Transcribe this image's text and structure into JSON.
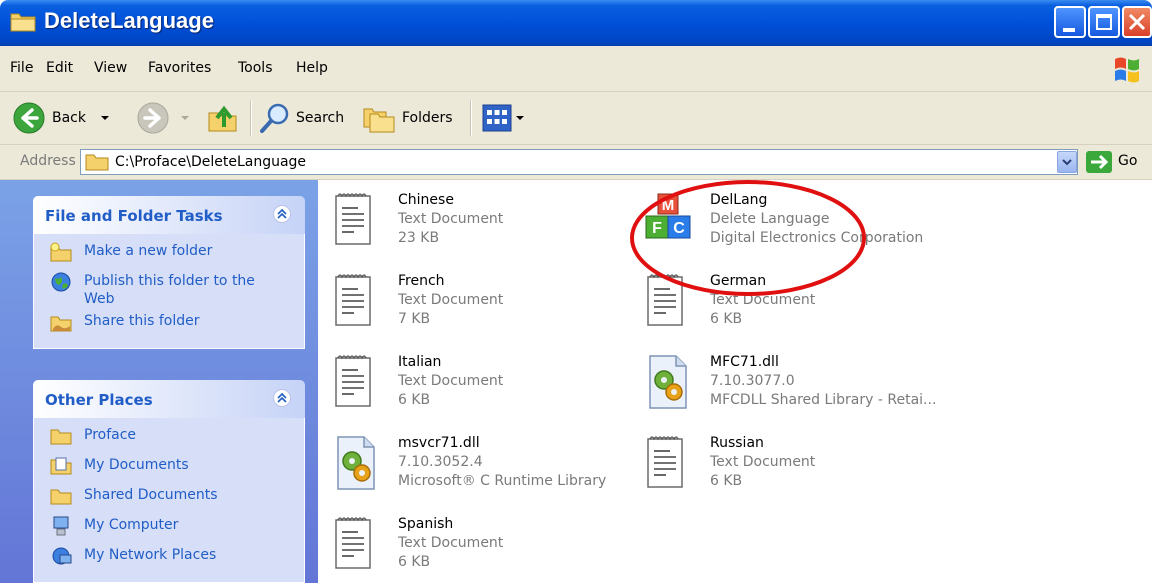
{
  "window": {
    "title": "DeleteLanguage",
    "title_icon": "folder-icon"
  },
  "menu": {
    "items": [
      "File",
      "Edit",
      "View",
      "Favorites",
      "Tools",
      "Help"
    ]
  },
  "toolbar": {
    "back_label": "Back",
    "search_label": "Search",
    "folders_label": "Folders"
  },
  "address": {
    "label": "Address",
    "path": "C:\\Proface\\DeleteLanguage",
    "go_label": "Go"
  },
  "left_pane": {
    "file_tasks": {
      "title": "File and Folder Tasks",
      "items": [
        {
          "label": "Make a new folder",
          "icon": "new-folder-icon"
        },
        {
          "label": "Publish this folder to the Web",
          "icon": "globe-icon"
        },
        {
          "label": "Share this folder",
          "icon": "share-folder-icon"
        }
      ]
    },
    "other_places": {
      "title": "Other Places",
      "items": [
        {
          "label": "Proface",
          "icon": "folder-icon"
        },
        {
          "label": "My Documents",
          "icon": "my-documents-icon"
        },
        {
          "label": "Shared Documents",
          "icon": "folder-icon"
        },
        {
          "label": "My Computer",
          "icon": "computer-icon"
        },
        {
          "label": "My Network Places",
          "icon": "network-icon"
        }
      ]
    }
  },
  "files": [
    {
      "name": "Chinese",
      "type": "Text Document",
      "size": "23 KB",
      "icon": "text-document-icon"
    },
    {
      "name": "DelLang",
      "type": "Delete Language",
      "size": "Digital Electronics Corporation",
      "icon": "mfc-app-icon"
    },
    {
      "name": "French",
      "type": "Text Document",
      "size": "7 KB",
      "icon": "text-document-icon"
    },
    {
      "name": "German",
      "type": "Text Document",
      "size": "6 KB",
      "icon": "text-document-icon"
    },
    {
      "name": "Italian",
      "type": "Text Document",
      "size": "6 KB",
      "icon": "text-document-icon"
    },
    {
      "name": "MFC71.dll",
      "type": "7.10.3077.0",
      "size": "MFCDLL Shared Library - Retai...",
      "icon": "dll-icon"
    },
    {
      "name": "msvcr71.dll",
      "type": "7.10.3052.4",
      "size": "Microsoft® C Runtime Library",
      "icon": "dll-icon"
    },
    {
      "name": "Russian",
      "type": "Text Document",
      "size": "6 KB",
      "icon": "text-document-icon"
    },
    {
      "name": "Spanish",
      "type": "Text Document",
      "size": "6 KB",
      "icon": "text-document-icon"
    }
  ],
  "colors": {
    "titlebar": "#0050d8",
    "task_link": "#215dc6",
    "annotation": "#e01010"
  }
}
